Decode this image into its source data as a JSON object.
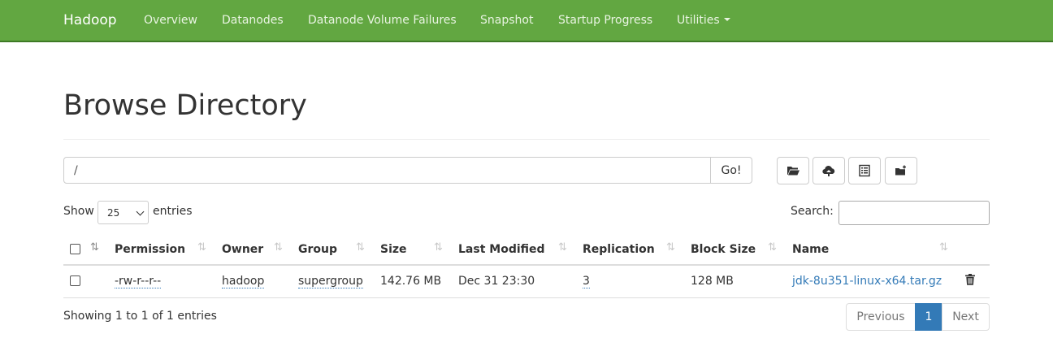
{
  "navbar": {
    "brand": "Hadoop",
    "items": [
      "Overview",
      "Datanodes",
      "Datanode Volume Failures",
      "Snapshot",
      "Startup Progress",
      "Utilities"
    ],
    "color": "#62a741"
  },
  "page": {
    "title": "Browse Directory"
  },
  "path_bar": {
    "value": "/",
    "go_label": "Go!"
  },
  "toolbar_icons": [
    "folder-open-icon",
    "cloud-upload-icon",
    "list-alt-icon",
    "folder-add-icon"
  ],
  "table_controls": {
    "show_label": "Show",
    "entries_value": "25",
    "entries_label": "entries",
    "search_label": "Search:",
    "search_value": ""
  },
  "table": {
    "columns": [
      "Permission",
      "Owner",
      "Group",
      "Size",
      "Last Modified",
      "Replication",
      "Block Size",
      "Name"
    ],
    "rows": [
      {
        "permission": "-rw-r--r--",
        "owner": "hadoop",
        "group": "supergroup",
        "size": "142.76 MB",
        "last_modified": "Dec 31 23:30",
        "replication": "3",
        "block_size": "128 MB",
        "name": "jdk-8u351-linux-x64.tar.gz"
      }
    ]
  },
  "footer": {
    "info": "Showing 1 to 1 of 1 entries",
    "pagination": {
      "previous": "Previous",
      "current": "1",
      "next": "Next"
    }
  },
  "colors": {
    "link": "#337ab7",
    "active_page": "#337ab7"
  }
}
